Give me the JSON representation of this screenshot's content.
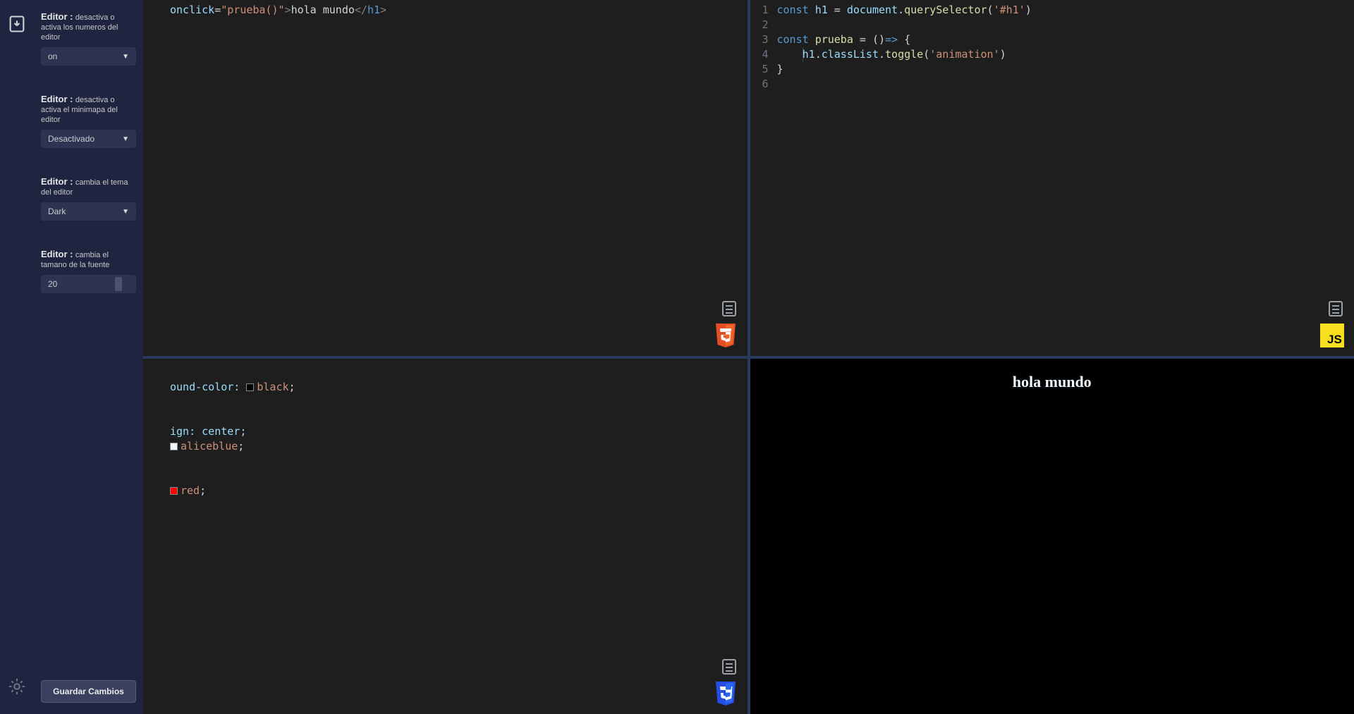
{
  "sidebar": {
    "settings": [
      {
        "title": "Editor :",
        "desc": "desactiva o activa los numeros del editor",
        "value": "on"
      },
      {
        "title": "Editor :",
        "desc": "desactiva o activa el minimapa del editor",
        "value": "Desactivado"
      },
      {
        "title": "Editor :",
        "desc": "cambia el tema del editor",
        "value": "Dark"
      },
      {
        "title": "Editor :",
        "desc": "cambia el tamano de la fuente",
        "value": "20"
      }
    ],
    "save_label": "Guardar Cambios"
  },
  "icons": {
    "download": "download-icon",
    "gear": "gear-icon"
  },
  "panes": {
    "html": {
      "lang": "HTML5",
      "visible_code": "onclick=\"prueba()\">hola mundo</h1>"
    },
    "js": {
      "lang": "JS",
      "lines": [
        "const h1 = document.querySelector('#h1')",
        "",
        "const prueba = ()=> {",
        "    h1.classList.toggle('animation')",
        "}",
        ""
      ]
    },
    "css": {
      "lang": "CSS3",
      "fragments": {
        "l1": "ound-color: ",
        "l1v": "black",
        "l4": "ign: center;",
        "l5v": "aliceblue",
        "l8v": "red"
      }
    },
    "preview": {
      "heading": "hola mundo"
    }
  }
}
